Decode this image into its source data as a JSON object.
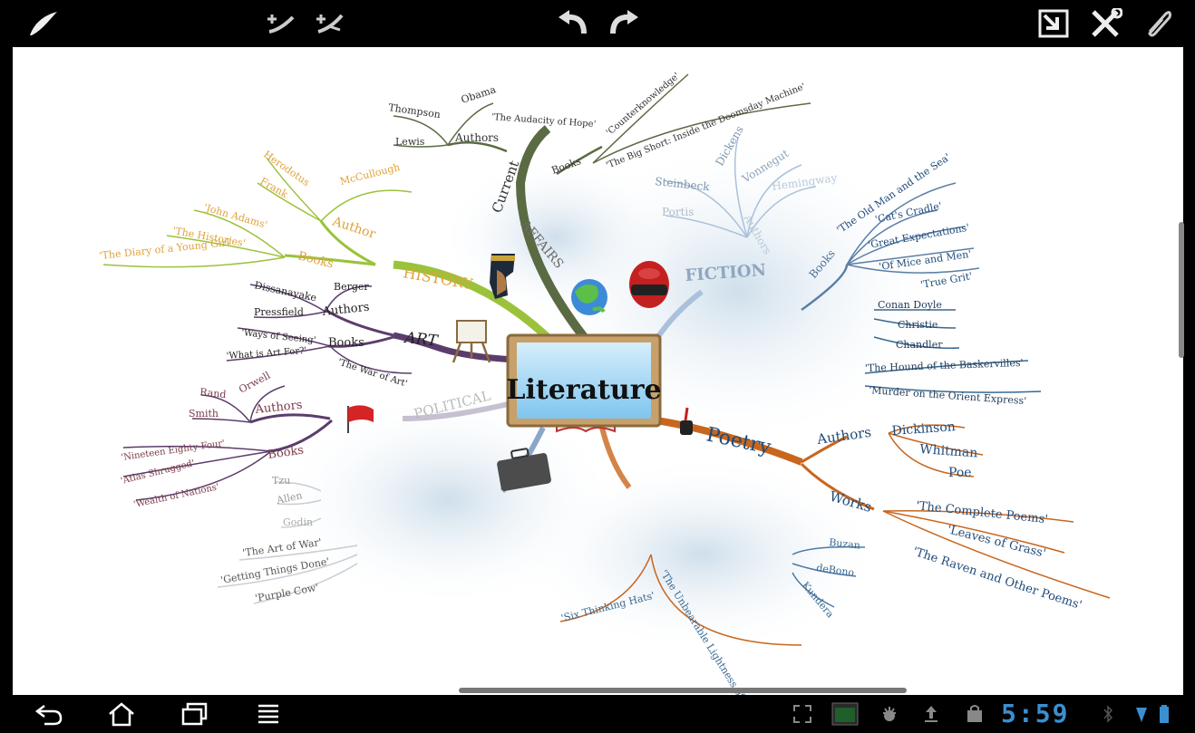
{
  "toolbar": {
    "icons": [
      "brush-icon",
      "branch-add-icon",
      "branch-add-alt-icon",
      "undo-icon",
      "redo-icon",
      "export-icon",
      "tools-icon",
      "attach-icon"
    ]
  },
  "colors": {
    "current": "#5a6b43",
    "history": "#9bc23b",
    "history_text": "#e0a23a",
    "art": "#5b3d6b",
    "political": "#7a3b47",
    "fiction": "#5a7fa6",
    "poetry": "#c8661c",
    "poetry_text": "#1f4a7a",
    "clock": "#3a8fd0"
  },
  "mindmap": {
    "center": "Literature",
    "current": {
      "label": "Current",
      "sub": "AFFAIRS",
      "authors_label": "Authors",
      "authors": [
        "Thompson",
        "Obama",
        "Lewis"
      ],
      "books_label": "Books",
      "books": [
        "'The Audacity of Hope'",
        "'Counterknowledge'",
        "'The Big Short: Inside the Doomsday Machine'"
      ]
    },
    "history": {
      "label": "HISTORY",
      "author_label": "Author",
      "authors": [
        "Herodotus",
        "McCullough",
        "Frank"
      ],
      "books_label": "Books",
      "books": [
        "'John Adams'",
        "'The Histories'",
        "'The Diary of a Young Girl'"
      ]
    },
    "art": {
      "label": "ART",
      "authors_label": "Authors",
      "authors": [
        "Dissanayake",
        "Berger",
        "Pressfield"
      ],
      "books_label": "Books",
      "books": [
        "'Ways of Seeing'",
        "'What is Art For?'",
        "'The War of Art'"
      ]
    },
    "political": {
      "label": "POLITICAL",
      "authors_label": "Authors",
      "authors": [
        "Rand",
        "Orwell",
        "Smith"
      ],
      "books_label": "Books",
      "books": [
        "'Nineteen Eighty-Four'",
        "'Atlas Shrugged'",
        "'Wealth of Nations'"
      ]
    },
    "business": {
      "authors": [
        "Tzu",
        "Allen",
        "Godin"
      ],
      "books": [
        "'The Art of War'",
        "'Getting Things Done'",
        "'Purple Cow'"
      ]
    },
    "fiction": {
      "label": "FICTION",
      "authors_label": "Authors",
      "authors": [
        "Steinbeck",
        "Dickens",
        "Vonnegut",
        "Hemingway",
        "Portis"
      ],
      "books_label": "Books",
      "books": [
        "'The Old Man and the Sea'",
        "'Cat's Cradle'",
        "'Great Expectations'",
        "'Of Mice and Men'",
        "'True Grit'"
      ],
      "mystery_authors": [
        "Conan Doyle",
        "Christie",
        "Chandler"
      ],
      "mystery_books": [
        "'The Hound of the Baskervilles'",
        "'Murder on the Orient Express'"
      ]
    },
    "poetry": {
      "label": "Poetry",
      "authors_label": "Authors",
      "authors": [
        "Dickinson",
        "Whitman",
        "Poe"
      ],
      "works_label": "Works",
      "works": [
        "'The Complete Poems'",
        "'Leaves of Grass'",
        "'The Raven and Other Poems'"
      ]
    },
    "thinking": {
      "authors": [
        "Buzan",
        "deBono",
        "Kundera"
      ],
      "books": [
        "'Six Thinking Hats'",
        "'The Unbearable Lightness of Being'"
      ]
    }
  },
  "status": {
    "clock": "5:59"
  }
}
